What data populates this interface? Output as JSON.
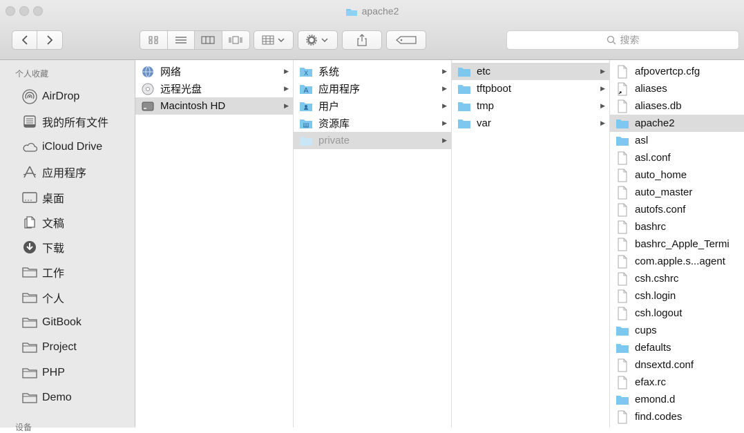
{
  "window": {
    "title": "apache2"
  },
  "toolbar": {
    "search_placeholder": "搜索"
  },
  "sidebar": {
    "favorites_header": "个人收藏",
    "devices_header": "设备",
    "items": [
      {
        "label": "AirDrop",
        "icon": "airdrop-icon"
      },
      {
        "label": "我的所有文件",
        "icon": "all-files-icon"
      },
      {
        "label": "iCloud Drive",
        "icon": "cloud-icon"
      },
      {
        "label": "应用程序",
        "icon": "applications-icon"
      },
      {
        "label": "桌面",
        "icon": "desktop-icon"
      },
      {
        "label": "文稿",
        "icon": "documents-icon"
      },
      {
        "label": "下载",
        "icon": "download-icon"
      },
      {
        "label": "工作",
        "icon": "folder-icon"
      },
      {
        "label": "个人",
        "icon": "folder-icon"
      },
      {
        "label": "GitBook",
        "icon": "folder-icon"
      },
      {
        "label": "Project",
        "icon": "folder-icon"
      },
      {
        "label": "PHP",
        "icon": "folder-icon"
      },
      {
        "label": "Demo",
        "icon": "folder-icon"
      }
    ]
  },
  "columns": {
    "col1": [
      {
        "label": "网络",
        "icon": "network-icon",
        "has_children": true
      },
      {
        "label": "远程光盘",
        "icon": "disc-icon",
        "has_children": true
      },
      {
        "label": "Macintosh HD",
        "icon": "hard-drive-icon",
        "has_children": true,
        "selected": true
      }
    ],
    "col2": [
      {
        "label": "系统",
        "icon": "system-folder-icon",
        "has_children": true
      },
      {
        "label": "应用程序",
        "icon": "applications-folder-icon",
        "has_children": true
      },
      {
        "label": "用户",
        "icon": "users-folder-icon",
        "has_children": true
      },
      {
        "label": "资源库",
        "icon": "library-folder-icon",
        "has_children": true
      },
      {
        "label": "private",
        "icon": "folder-icon",
        "has_children": true,
        "selected": true,
        "dimmed": true
      }
    ],
    "col3": [
      {
        "label": "etc",
        "icon": "folder-icon",
        "has_children": true,
        "selected": true
      },
      {
        "label": "tftpboot",
        "icon": "folder-icon",
        "has_children": true
      },
      {
        "label": "tmp",
        "icon": "folder-icon",
        "has_children": true
      },
      {
        "label": "var",
        "icon": "folder-icon",
        "has_children": true
      }
    ],
    "col4": [
      {
        "label": "afpovertcp.cfg",
        "icon": "file-icon"
      },
      {
        "label": "aliases",
        "icon": "alias-file-icon"
      },
      {
        "label": "aliases.db",
        "icon": "file-icon"
      },
      {
        "label": "apache2",
        "icon": "folder-icon",
        "selected": true
      },
      {
        "label": "asl",
        "icon": "folder-icon"
      },
      {
        "label": "asl.conf",
        "icon": "file-icon"
      },
      {
        "label": "auto_home",
        "icon": "file-icon"
      },
      {
        "label": "auto_master",
        "icon": "file-icon"
      },
      {
        "label": "autofs.conf",
        "icon": "file-icon"
      },
      {
        "label": "bashrc",
        "icon": "file-icon"
      },
      {
        "label": "bashrc_Apple_Termi",
        "icon": "file-icon"
      },
      {
        "label": "com.apple.s...agent",
        "icon": "file-icon"
      },
      {
        "label": "csh.cshrc",
        "icon": "file-icon"
      },
      {
        "label": "csh.login",
        "icon": "file-icon"
      },
      {
        "label": "csh.logout",
        "icon": "file-icon"
      },
      {
        "label": "cups",
        "icon": "folder-icon"
      },
      {
        "label": "defaults",
        "icon": "folder-icon"
      },
      {
        "label": "dnsextd.conf",
        "icon": "file-icon"
      },
      {
        "label": "efax.rc",
        "icon": "file-icon"
      },
      {
        "label": "emond.d",
        "icon": "folder-icon"
      },
      {
        "label": "find.codes",
        "icon": "file-icon"
      }
    ]
  },
  "colors": {
    "folder": "#7ec7ef",
    "selection": "#dcdcdc",
    "sidebar_bg": "#e9e9ea"
  }
}
